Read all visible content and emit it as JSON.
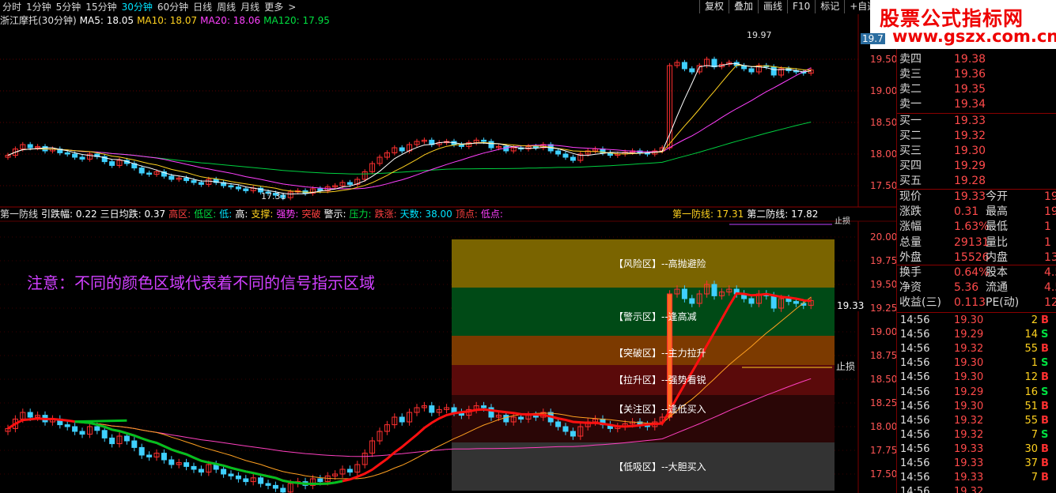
{
  "periods": [
    "分时",
    "1分钟",
    "5分钟",
    "15分钟",
    "30分钟",
    "60分钟",
    "日线",
    "周线",
    "月线",
    "更多"
  ],
  "active_period": "30分钟",
  "more_arrow": ">",
  "toolbar": [
    "复权",
    "叠加",
    "画线",
    "F10",
    "标记",
    "+自选"
  ],
  "logo": {
    "main": "股票公式指标网",
    "url": "www.gszx.com.cn"
  },
  "top_panel": {
    "legend": [
      {
        "text": "浙江摩托(30分钟)",
        "color": "#e0e0e0"
      },
      {
        "text": "MA5: 18.05",
        "color": "#ffffff"
      },
      {
        "text": "MA10: 18.07",
        "color": "#ffd21f"
      },
      {
        "text": "MA20: 18.06",
        "color": "#ff40ff"
      },
      {
        "text": "MA120: 17.95",
        "color": "#00e040"
      }
    ],
    "high_label": "19.97",
    "low_label": "17.31",
    "price_badge": "19.7",
    "axis": [
      "19.50",
      "19.00",
      "18.50",
      "18.00",
      "17.50"
    ]
  },
  "bottom_panel": {
    "legend": [
      {
        "text": "第一防线",
        "color": "#e0e0e0"
      },
      {
        "text": "引跌幅: 0.22",
        "color": "#ffffff"
      },
      {
        "text": "三日均跌: 0.37",
        "color": "#ffffff"
      },
      {
        "text": "高区:",
        "color": "#ff4040"
      },
      {
        "text": "低区:",
        "color": "#00e040"
      },
      {
        "text": "低:",
        "color": "#00e5ff"
      },
      {
        "text": "高:",
        "color": "#ffffff"
      },
      {
        "text": "支撑:",
        "color": "#ffd21f"
      },
      {
        "text": "强势:",
        "color": "#ff40ff"
      },
      {
        "text": "突破",
        "color": "#ff4040"
      },
      {
        "text": "警示:",
        "color": "#ffffff"
      },
      {
        "text": "压力:",
        "color": "#00e040"
      },
      {
        "text": "跌涨:",
        "color": "#ff4040"
      },
      {
        "text": "天数: 38.00",
        "color": "#00e5ff"
      },
      {
        "text": "顶点:",
        "color": "#ff4040"
      },
      {
        "text": "低点:",
        "color": "#ff40ff"
      }
    ],
    "legend_right": [
      {
        "text": "第一防线: 17.31",
        "color": "#ffd21f"
      },
      {
        "text": "第二防线: 17.82",
        "color": "#ffffff"
      }
    ],
    "note": "注意：不同的颜色区域代表着不同的信号指示区域",
    "zones": [
      {
        "label": "【风险区】--高抛避险",
        "color": "#7a6400"
      },
      {
        "label": "【警示区】--逢高减",
        "color": "#004a16"
      },
      {
        "label": "【突破区】--主力拉升",
        "color": "#7c3a00"
      },
      {
        "label": "【拉升区】--强势看锐",
        "color": "#5a0a0a"
      },
      {
        "label": "【关注区】--逢低买入",
        "color": "#2a0606"
      },
      {
        "label": "【低吸区】--大胆买入",
        "color": "#333333"
      }
    ],
    "stop_loss": "止损",
    "stop_top": "止损",
    "price_badge": "19.33",
    "axis": [
      "20.00",
      "19.75",
      "19.50",
      "19.25",
      "19.00",
      "18.75",
      "18.50",
      "18.25",
      "18.00",
      "17.75",
      "17.50"
    ]
  },
  "quote": {
    "book": [
      {
        "label": "卖四",
        "price": "19.38"
      },
      {
        "label": "卖三",
        "price": "19.36"
      },
      {
        "label": "卖二",
        "price": "19.35"
      },
      {
        "label": "卖一",
        "price": "19.34"
      },
      {
        "label": "买一",
        "price": "19.33"
      },
      {
        "label": "买二",
        "price": "19.32"
      },
      {
        "label": "买三",
        "price": "19.30"
      },
      {
        "label": "买四",
        "price": "19.29"
      },
      {
        "label": "买五",
        "price": "19.28"
      }
    ],
    "stats": [
      {
        "l": "现价",
        "v": "19.33",
        "l2": "今开",
        "v2": "19"
      },
      {
        "l": "涨跌",
        "v": "0.31",
        "l2": "最高",
        "v2": "19"
      },
      {
        "l": "涨幅",
        "v": "1.63%",
        "l2": "最低",
        "v2": "1"
      },
      {
        "l": "总量",
        "v": "29131",
        "l2": "量比",
        "v2": "1"
      },
      {
        "l": "外盘",
        "v": "15526",
        "l2": "内盘",
        "v2": "13"
      },
      {
        "l": "换手",
        "v": "0.64%",
        "l2": "股本",
        "v2": "4.5"
      },
      {
        "l": "净资",
        "v": "5.36",
        "l2": "流通",
        "v2": "4.5"
      },
      {
        "l": "收益(三)",
        "v": "0.113",
        "l2": "PE(动)",
        "v2": "12"
      }
    ],
    "ticks": [
      {
        "t": "14:56",
        "p": "19.30",
        "q": "2",
        "s": "B"
      },
      {
        "t": "14:56",
        "p": "19.29",
        "q": "14",
        "s": "S"
      },
      {
        "t": "14:56",
        "p": "19.32",
        "q": "55",
        "s": "B"
      },
      {
        "t": "14:56",
        "p": "19.30",
        "q": "1",
        "s": "S"
      },
      {
        "t": "14:56",
        "p": "19.30",
        "q": "12",
        "s": "B"
      },
      {
        "t": "14:56",
        "p": "19.29",
        "q": "16",
        "s": "S"
      },
      {
        "t": "14:56",
        "p": "19.30",
        "q": "51",
        "s": "B"
      },
      {
        "t": "14:56",
        "p": "19.32",
        "q": "55",
        "s": "B"
      },
      {
        "t": "14:56",
        "p": "19.32",
        "q": "7",
        "s": "S"
      },
      {
        "t": "14:56",
        "p": "19.33",
        "q": "30",
        "s": "B"
      },
      {
        "t": "14:56",
        "p": "19.33",
        "q": "37",
        "s": "B"
      },
      {
        "t": "14:56",
        "p": "19.33",
        "q": "7",
        "s": "B"
      },
      {
        "t": "14:56",
        "p": "19.32",
        "q": "",
        "s": ""
      }
    ]
  },
  "chart_data": {
    "type": "candlestick",
    "closes": [
      17.98,
      18.08,
      18.15,
      18.1,
      18.12,
      18.05,
      18.08,
      18.02,
      18.0,
      17.95,
      17.92,
      18.0,
      17.96,
      17.88,
      17.82,
      17.9,
      17.85,
      17.78,
      17.7,
      17.68,
      17.72,
      17.65,
      17.6,
      17.62,
      17.58,
      17.55,
      17.52,
      17.6,
      17.55,
      17.5,
      17.48,
      17.45,
      17.42,
      17.46,
      17.4,
      17.38,
      17.35,
      17.31,
      17.4,
      17.42,
      17.38,
      17.45,
      17.42,
      17.48,
      17.5,
      17.55,
      17.52,
      17.6,
      17.72,
      17.85,
      17.95,
      18.02,
      18.1,
      18.05,
      18.15,
      18.2,
      18.22,
      18.15,
      18.18,
      18.2,
      18.15,
      18.12,
      18.18,
      18.22,
      18.2,
      18.1,
      18.12,
      18.05,
      18.1,
      18.08,
      18.12,
      18.1,
      18.15,
      18.05,
      18.0,
      17.95,
      17.9,
      18.0,
      18.05,
      18.08,
      18.02,
      17.98,
      18.0,
      18.03,
      18.05,
      18.02,
      18.0,
      18.05,
      18.1,
      19.4,
      19.45,
      19.35,
      19.3,
      19.4,
      19.5,
      19.38,
      19.42,
      19.45,
      19.4,
      19.35,
      19.3,
      19.4,
      19.38,
      19.25,
      19.35,
      19.32,
      19.3,
      19.28,
      19.33
    ]
  }
}
